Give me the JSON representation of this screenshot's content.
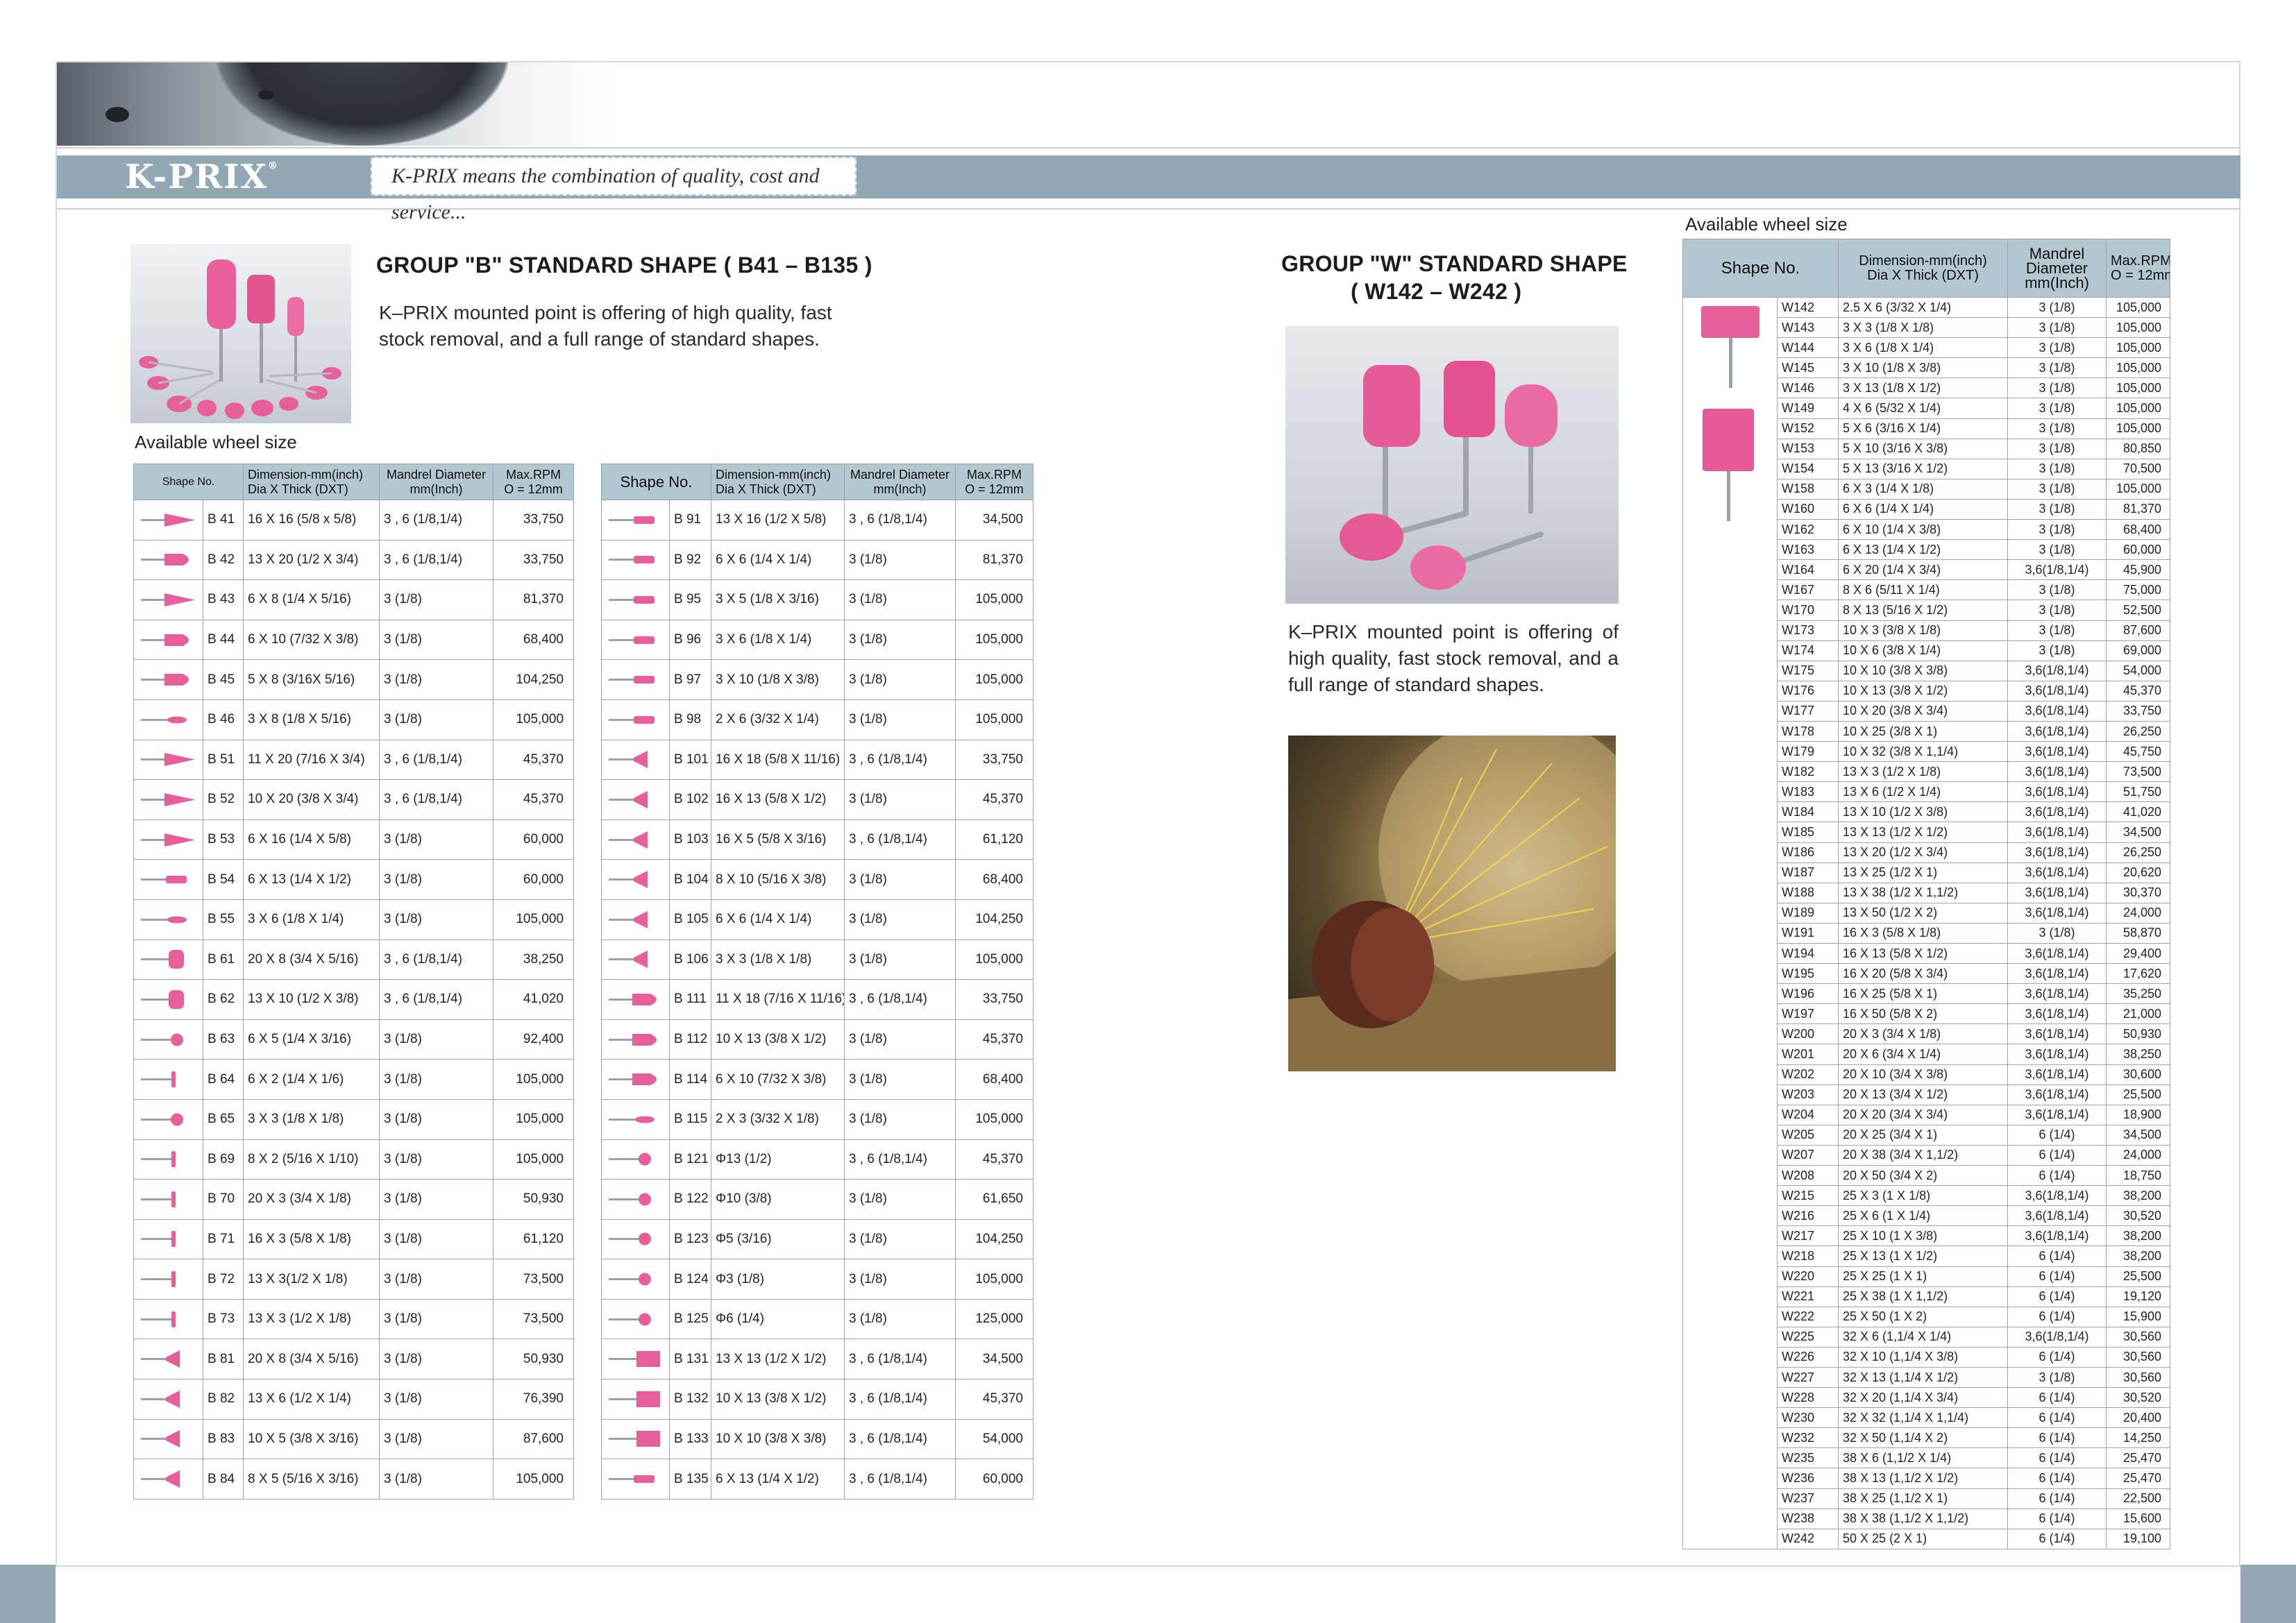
{
  "brand": {
    "logo": "K-PRIX",
    "tagline": "K-PRIX means the combination of quality, cost and service..."
  },
  "colors": {
    "band": "#93a8b5",
    "table_header": "#b3c7d1",
    "stone_pink": "#e75f9a"
  },
  "group_b": {
    "title": "GROUP \"B\" STANDARD SHAPE ( B41 – B135 )",
    "description": "K–PRIX mounted point is offering of high quality, fast stock removal, and a full range of standard shapes.",
    "available_label": "Available wheel size",
    "headers": {
      "shape": "Shape No.",
      "dimension": "Dimension-mm(inch)",
      "dimension_sub": "Dia X Thick (DXT)",
      "mandrel": "Mandrel Diameter",
      "mandrel_sub": "mm(Inch)",
      "rpm": "Max.RPM",
      "rpm_sub": "O = 12mm"
    },
    "rows_left": [
      {
        "no": "B 41",
        "dim": "16 X 16 (5/8 x 5/8)",
        "man": "3 , 6 (1/8,1/4)",
        "rpm": "33,750",
        "icon": "cone"
      },
      {
        "no": "B 42",
        "dim": "13 X 20 (1/2 X 3/4)",
        "man": "3 , 6 (1/8,1/4)",
        "rpm": "33,750",
        "icon": "bullet"
      },
      {
        "no": "B 43",
        "dim": "6 X 8 (1/4 X 5/16)",
        "man": "3 (1/8)",
        "rpm": "81,370",
        "icon": "cone"
      },
      {
        "no": "B 44",
        "dim": "6 X 10 (7/32 X 3/8)",
        "man": "3 (1/8)",
        "rpm": "68,400",
        "icon": "bullet"
      },
      {
        "no": "B 45",
        "dim": "5 X 8 (3/16X 5/16)",
        "man": "3 (1/8)",
        "rpm": "104,250",
        "icon": "bullet"
      },
      {
        "no": "B 46",
        "dim": "3 X 8 (1/8 X 5/16)",
        "man": "3 (1/8)",
        "rpm": "105,000",
        "icon": "oval"
      },
      {
        "no": "B 51",
        "dim": "11 X 20 (7/16 X 3/4)",
        "man": "3 , 6 (1/8,1/4)",
        "rpm": "45,370",
        "icon": "cone"
      },
      {
        "no": "B 52",
        "dim": "10 X 20 (3/8 X 3/4)",
        "man": "3 , 6 (1/8,1/4)",
        "rpm": "45,370",
        "icon": "cone"
      },
      {
        "no": "B 53",
        "dim": "6 X 16 (1/4 X 5/8)",
        "man": "3 (1/8)",
        "rpm": "60,000",
        "icon": "cone"
      },
      {
        "no": "B 54",
        "dim": "6 X 13 (1/4 X 1/2)",
        "man": "3 (1/8)",
        "rpm": "60,000",
        "icon": "cyl"
      },
      {
        "no": "B 55",
        "dim": "3 X 6 (1/8 X 1/4)",
        "man": "3 (1/8)",
        "rpm": "105,000",
        "icon": "oval"
      },
      {
        "no": "B 61",
        "dim": "20 X 8 (3/4 X 5/16)",
        "man": "3 , 6 (1/8,1/4)",
        "rpm": "38,250",
        "icon": "wheel"
      },
      {
        "no": "B 62",
        "dim": "13 X 10 (1/2 X 3/8)",
        "man": "3 , 6 (1/8,1/4)",
        "rpm": "41,020",
        "icon": "wheel"
      },
      {
        "no": "B 63",
        "dim": "6 X 5 (1/4 X 3/16)",
        "man": "3 (1/8)",
        "rpm": "92,400",
        "icon": "ball"
      },
      {
        "no": "B 64",
        "dim": "6 X 2 (1/4 X 1/6)",
        "man": "3 (1/8)",
        "rpm": "105,000",
        "icon": "disc"
      },
      {
        "no": "B 65",
        "dim": "3 X 3 (1/8 X 1/8)",
        "man": "3 (1/8)",
        "rpm": "105,000",
        "icon": "ball"
      },
      {
        "no": "B 69",
        "dim": "8 X 2 (5/16 X 1/10)",
        "man": "3 (1/8)",
        "rpm": "105,000",
        "icon": "disc"
      },
      {
        "no": "B 70",
        "dim": "20 X 3 (3/4 X 1/8)",
        "man": "3 (1/8)",
        "rpm": "50,930",
        "icon": "disc"
      },
      {
        "no": "B 71",
        "dim": "16 X 3 (5/8 X 1/8)",
        "man": "3 (1/8)",
        "rpm": "61,120",
        "icon": "disc"
      },
      {
        "no": "B 72",
        "dim": "13 X 3(1/2 X 1/8)",
        "man": "3 (1/8)",
        "rpm": "73,500",
        "icon": "disc"
      },
      {
        "no": "B 73",
        "dim": "13 X 3 (1/2 X 1/8)",
        "man": "3 (1/8)",
        "rpm": "73,500",
        "icon": "disc"
      },
      {
        "no": "B 81",
        "dim": "20 X 8 (3/4 X 5/16)",
        "man": "3 (1/8)",
        "rpm": "50,930",
        "icon": "flare"
      },
      {
        "no": "B 82",
        "dim": "13 X 6 (1/2 X 1/4)",
        "man": "3 (1/8)",
        "rpm": "76,390",
        "icon": "flare"
      },
      {
        "no": "B 83",
        "dim": "10 X 5 (3/8 X 3/16)",
        "man": "3 (1/8)",
        "rpm": "87,600",
        "icon": "flare"
      },
      {
        "no": "B 84",
        "dim": "8 X 5 (5/16 X 3/16)",
        "man": "3 (1/8)",
        "rpm": "105,000",
        "icon": "flare"
      }
    ],
    "rows_right": [
      {
        "no": "B 91",
        "dim": "13 X 16 (1/2 X 5/8)",
        "man": "3 , 6 (1/8,1/4)",
        "rpm": "34,500",
        "icon": "cyl"
      },
      {
        "no": "B 92",
        "dim": "6 X 6 (1/4 X 1/4)",
        "man": "3 (1/8)",
        "rpm": "81,370",
        "icon": "cyl"
      },
      {
        "no": "B 95",
        "dim": "3 X 5 (1/8 X 3/16)",
        "man": "3 (1/8)",
        "rpm": "105,000",
        "icon": "cyl"
      },
      {
        "no": "B 96",
        "dim": "3 X 6 (1/8 X 1/4)",
        "man": "3 (1/8)",
        "rpm": "105,000",
        "icon": "cyl"
      },
      {
        "no": "B 97",
        "dim": "3 X 10 (1/8 X 3/8)",
        "man": "3 (1/8)",
        "rpm": "105,000",
        "icon": "cyl"
      },
      {
        "no": "B 98",
        "dim": "2 X 6 (3/32 X 1/4)",
        "man": "3 (1/8)",
        "rpm": "105,000",
        "icon": "cyl"
      },
      {
        "no": "B 101",
        "dim": "16 X 18 (5/8 X 11/16)",
        "man": "3 , 6 (1/8,1/4)",
        "rpm": "33,750",
        "icon": "flare"
      },
      {
        "no": "B 102",
        "dim": "16 X 13 (5/8 X 1/2)",
        "man": "3 (1/8)",
        "rpm": "45,370",
        "icon": "flare"
      },
      {
        "no": "B 103",
        "dim": "16 X 5 (5/8 X 3/16)",
        "man": "3 , 6 (1/8,1/4)",
        "rpm": "61,120",
        "icon": "flare"
      },
      {
        "no": "B 104",
        "dim": "8 X 10 (5/16 X 3/8)",
        "man": "3 (1/8)",
        "rpm": "68,400",
        "icon": "flare"
      },
      {
        "no": "B 105",
        "dim": "6 X 6 (1/4 X 1/4)",
        "man": "3 (1/8)",
        "rpm": "104,250",
        "icon": "flare"
      },
      {
        "no": "B 106",
        "dim": "3 X 3 (1/8 X 1/8)",
        "man": "3 (1/8)",
        "rpm": "105,000",
        "icon": "flare"
      },
      {
        "no": "B 111",
        "dim": "11 X 18 (7/16 X 11/16)",
        "man": "3 , 6 (1/8,1/4)",
        "rpm": "33,750",
        "icon": "bullet"
      },
      {
        "no": "B 112",
        "dim": "10 X 13 (3/8 X 1/2)",
        "man": "3 (1/8)",
        "rpm": "45,370",
        "icon": "bullet"
      },
      {
        "no": "B 114",
        "dim": "6 X 10 (7/32 X 3/8)",
        "man": "3 (1/8)",
        "rpm": "68,400",
        "icon": "bullet"
      },
      {
        "no": "B 115",
        "dim": "2 X 3 (3/32 X 1/8)",
        "man": "3 (1/8)",
        "rpm": "105,000",
        "icon": "oval"
      },
      {
        "no": "B 121",
        "dim": "Φ13 (1/2)",
        "man": "3 , 6 (1/8,1/4)",
        "rpm": "45,370",
        "icon": "ball"
      },
      {
        "no": "B 122",
        "dim": "Φ10  (3/8)",
        "man": "3 (1/8)",
        "rpm": "61,650",
        "icon": "ball"
      },
      {
        "no": "B 123",
        "dim": "Φ5 (3/16)",
        "man": "3 (1/8)",
        "rpm": "104,250",
        "icon": "ball"
      },
      {
        "no": "B 124",
        "dim": "Φ3 (1/8)",
        "man": "3 (1/8)",
        "rpm": "105,000",
        "icon": "ball"
      },
      {
        "no": "B 125",
        "dim": "Φ6 (1/4)",
        "man": "3 (1/8)",
        "rpm": "125,000",
        "icon": "ball"
      },
      {
        "no": "B 131",
        "dim": "13 X 13 (1/2 X 1/2)",
        "man": "3 , 6 (1/8,1/4)",
        "rpm": "34,500",
        "icon": "block"
      },
      {
        "no": "B 132",
        "dim": "10 X 13 (3/8 X 1/2)",
        "man": "3 , 6 (1/8,1/4)",
        "rpm": "45,370",
        "icon": "block"
      },
      {
        "no": "B 133",
        "dim": "10 X 10 (3/8 X 3/8)",
        "man": "3 , 6 (1/8,1/4)",
        "rpm": "54,000",
        "icon": "block"
      },
      {
        "no": "B 135",
        "dim": "6 X 13 (1/4 X 1/2)",
        "man": "3 , 6 (1/8,1/4)",
        "rpm": "60,000",
        "icon": "cyl"
      }
    ]
  },
  "group_w": {
    "title": "GROUP \"W\" STANDARD SHAPE",
    "subtitle": "( W142 – W242 )",
    "description": "K–PRIX mounted point is offering of high quality, fast stock removal, and a full range of standard shapes.",
    "available_label": "Available wheel size",
    "headers": {
      "shape": "Shape No.",
      "dimension": "Dimension-mm(inch)",
      "dimension_sub": "Dia X Thick (DXT)",
      "mandrel": "Mandrel",
      "mandrel_2": "Diameter",
      "mandrel_3": "mm(Inch)",
      "rpm": "Max.RPM",
      "rpm_sub": "O = 12mm"
    },
    "rows": [
      {
        "no": "W142",
        "dim": "2.5 X 6 (3/32 X 1/4)",
        "man": "3 (1/8)",
        "rpm": "105,000"
      },
      {
        "no": "W143",
        "dim": "3 X 3 (1/8 X 1/8)",
        "man": "3 (1/8)",
        "rpm": "105,000"
      },
      {
        "no": "W144",
        "dim": "3 X 6 (1/8 X 1/4)",
        "man": "3 (1/8)",
        "rpm": "105,000"
      },
      {
        "no": "W145",
        "dim": "3 X 10 (1/8 X 3/8)",
        "man": "3 (1/8)",
        "rpm": "105,000"
      },
      {
        "no": "W146",
        "dim": "3 X 13 (1/8 X 1/2)",
        "man": "3 (1/8)",
        "rpm": "105,000"
      },
      {
        "no": "W149",
        "dim": "4 X 6 (5/32 X 1/4)",
        "man": "3 (1/8)",
        "rpm": "105,000"
      },
      {
        "no": "W152",
        "dim": "5 X 6 (3/16 X 1/4)",
        "man": "3 (1/8)",
        "rpm": "105,000"
      },
      {
        "no": "W153",
        "dim": "5 X 10 (3/16 X 3/8)",
        "man": "3 (1/8)",
        "rpm": "80,850"
      },
      {
        "no": "W154",
        "dim": "5 X 13 (3/16 X 1/2)",
        "man": "3 (1/8)",
        "rpm": "70,500"
      },
      {
        "no": "W158",
        "dim": "6 X 3 (1/4 X 1/8)",
        "man": "3 (1/8)",
        "rpm": "105,000"
      },
      {
        "no": "W160",
        "dim": "6 X 6 (1/4 X 1/4)",
        "man": "3 (1/8)",
        "rpm": "81,370"
      },
      {
        "no": "W162",
        "dim": "6 X 10 (1/4 X 3/8)",
        "man": "3 (1/8)",
        "rpm": "68,400"
      },
      {
        "no": "W163",
        "dim": "6 X 13 (1/4 X 1/2)",
        "man": "3 (1/8)",
        "rpm": "60,000"
      },
      {
        "no": "W164",
        "dim": "6 X 20 (1/4 X 3/4)",
        "man": "3,6(1/8,1/4)",
        "rpm": "45,900"
      },
      {
        "no": "W167",
        "dim": "8 X 6 (5/11 X 1/4)",
        "man": "3 (1/8)",
        "rpm": "75,000"
      },
      {
        "no": "W170",
        "dim": "8 X 13 (5/16 X 1/2)",
        "man": "3 (1/8)",
        "rpm": "52,500"
      },
      {
        "no": "W173",
        "dim": "10 X 3 (3/8 X 1/8)",
        "man": "3 (1/8)",
        "rpm": "87,600"
      },
      {
        "no": "W174",
        "dim": "10 X 6 (3/8 X 1/4)",
        "man": "3 (1/8)",
        "rpm": "69,000"
      },
      {
        "no": "W175",
        "dim": "10 X 10 (3/8 X 3/8)",
        "man": "3,6(1/8,1/4)",
        "rpm": "54,000"
      },
      {
        "no": "W176",
        "dim": "10 X 13 (3/8 X 1/2)",
        "man": "3,6(1/8,1/4)",
        "rpm": "45,370"
      },
      {
        "no": "W177",
        "dim": "10 X 20 (3/8 X 3/4)",
        "man": "3,6(1/8,1/4)",
        "rpm": "33,750"
      },
      {
        "no": "W178",
        "dim": "10 X 25 (3/8 X 1)",
        "man": "3,6(1/8,1/4)",
        "rpm": "26,250"
      },
      {
        "no": "W179",
        "dim": "10 X 32 (3/8 X 1,1/4)",
        "man": "3,6(1/8,1/4)",
        "rpm": "45,750"
      },
      {
        "no": "W182",
        "dim": "13 X 3 (1/2 X 1/8)",
        "man": "3,6(1/8,1/4)",
        "rpm": "73,500"
      },
      {
        "no": "W183",
        "dim": "13 X 6 (1/2 X 1/4)",
        "man": "3,6(1/8,1/4)",
        "rpm": "51,750"
      },
      {
        "no": "W184",
        "dim": "13 X 10 (1/2 X 3/8)",
        "man": "3,6(1/8,1/4)",
        "rpm": "41,020"
      },
      {
        "no": "W185",
        "dim": "13 X 13 (1/2 X 1/2)",
        "man": "3,6(1/8,1/4)",
        "rpm": "34,500"
      },
      {
        "no": "W186",
        "dim": "13 X 20 (1/2 X 3/4)",
        "man": "3,6(1/8,1/4)",
        "rpm": "26,250"
      },
      {
        "no": "W187",
        "dim": "13 X 25 (1/2 X 1)",
        "man": "3,6(1/8,1/4)",
        "rpm": "20,620"
      },
      {
        "no": "W188",
        "dim": "13 X 38 (1/2 X 1,1/2)",
        "man": "3,6(1/8,1/4)",
        "rpm": "30,370"
      },
      {
        "no": "W189",
        "dim": "13 X 50 (1/2 X 2)",
        "man": "3,6(1/8,1/4)",
        "rpm": "24,000"
      },
      {
        "no": "W191",
        "dim": "16 X 3 (5/8 X 1/8)",
        "man": "3 (1/8)",
        "rpm": "58,870"
      },
      {
        "no": "W194",
        "dim": "16 X 13 (5/8 X 1/2)",
        "man": "3,6(1/8,1/4)",
        "rpm": "29,400"
      },
      {
        "no": "W195",
        "dim": "16 X 20 (5/8 X 3/4)",
        "man": "3,6(1/8,1/4)",
        "rpm": "17,620"
      },
      {
        "no": "W196",
        "dim": "16 X 25 (5/8 X 1)",
        "man": "3,6(1/8,1/4)",
        "rpm": "35,250"
      },
      {
        "no": "W197",
        "dim": "16 X 50 (5/8 X 2)",
        "man": "3,6(1/8,1/4)",
        "rpm": "21,000"
      },
      {
        "no": "W200",
        "dim": "20 X 3 (3/4 X 1/8)",
        "man": "3,6(1/8,1/4)",
        "rpm": "50,930"
      },
      {
        "no": "W201",
        "dim": "20 X 6 (3/4 X 1/4)",
        "man": "3,6(1/8,1/4)",
        "rpm": "38,250"
      },
      {
        "no": "W202",
        "dim": "20 X 10 (3/4 X 3/8)",
        "man": "3,6(1/8,1/4)",
        "rpm": "30,600"
      },
      {
        "no": "W203",
        "dim": "20 X 13 (3/4 X 1/2)",
        "man": "3,6(1/8,1/4)",
        "rpm": "25,500"
      },
      {
        "no": "W204",
        "dim": "20 X 20 (3/4 X 3/4)",
        "man": "3,6(1/8,1/4)",
        "rpm": "18,900"
      },
      {
        "no": "W205",
        "dim": "20 X 25 (3/4 X 1)",
        "man": "6 (1/4)",
        "rpm": "34,500"
      },
      {
        "no": "W207",
        "dim": "20 X 38 (3/4 X 1,1/2)",
        "man": "6 (1/4)",
        "rpm": "24,000"
      },
      {
        "no": "W208",
        "dim": "20 X 50 (3/4 X 2)",
        "man": "6 (1/4)",
        "rpm": "18,750"
      },
      {
        "no": "W215",
        "dim": "25 X 3 (1 X 1/8)",
        "man": "3,6(1/8,1/4)",
        "rpm": "38,200"
      },
      {
        "no": "W216",
        "dim": "25 X 6 (1 X 1/4)",
        "man": "3,6(1/8,1/4)",
        "rpm": "30,520"
      },
      {
        "no": "W217",
        "dim": "25 X 10 (1 X 3/8)",
        "man": "3,6(1/8,1/4)",
        "rpm": "38,200"
      },
      {
        "no": "W218",
        "dim": "25 X 13 (1 X 1/2)",
        "man": "6 (1/4)",
        "rpm": "38,200"
      },
      {
        "no": "W220",
        "dim": "25 X 25 (1 X 1)",
        "man": "6 (1/4)",
        "rpm": "25,500"
      },
      {
        "no": "W221",
        "dim": "25 X 38 (1 X 1,1/2)",
        "man": "6 (1/4)",
        "rpm": "19,120"
      },
      {
        "no": "W222",
        "dim": "25 X 50 (1 X 2)",
        "man": "6 (1/4)",
        "rpm": "15,900"
      },
      {
        "no": "W225",
        "dim": "32 X 6 (1,1/4 X 1/4)",
        "man": "3,6(1/8,1/4)",
        "rpm": "30,560"
      },
      {
        "no": "W226",
        "dim": "32 X 10 (1,1/4 X 3/8)",
        "man": "6 (1/4)",
        "rpm": "30,560"
      },
      {
        "no": "W227",
        "dim": "32 X 13 (1,1/4 X 1/2)",
        "man": "3 (1/8)",
        "rpm": "30,560"
      },
      {
        "no": "W228",
        "dim": "32 X 20 (1,1/4 X 3/4)",
        "man": "6 (1/4)",
        "rpm": "30,520"
      },
      {
        "no": "W230",
        "dim": "32 X 32 (1,1/4 X 1,1/4)",
        "man": "6 (1/4)",
        "rpm": "20,400"
      },
      {
        "no": "W232",
        "dim": "32 X 50 (1,1/4 X 2)",
        "man": "6 (1/4)",
        "rpm": "14,250"
      },
      {
        "no": "W235",
        "dim": "38 X 6 (1,1/2 X 1/4)",
        "man": "6 (1/4)",
        "rpm": "25,470"
      },
      {
        "no": "W236",
        "dim": "38 X 13 (1,1/2 X 1/2)",
        "man": "6 (1/4)",
        "rpm": "25,470"
      },
      {
        "no": "W237",
        "dim": "38 X 25 (1,1/2 X 1)",
        "man": "6 (1/4)",
        "rpm": "22,500"
      },
      {
        "no": "W238",
        "dim": "38 X 38 (1,1/2 X 1,1/2)",
        "man": "6 (1/4)",
        "rpm": "15,600"
      },
      {
        "no": "W242",
        "dim": "50 X 25 (2 X 1)",
        "man": "6 (1/4)",
        "rpm": "19,100"
      }
    ]
  }
}
